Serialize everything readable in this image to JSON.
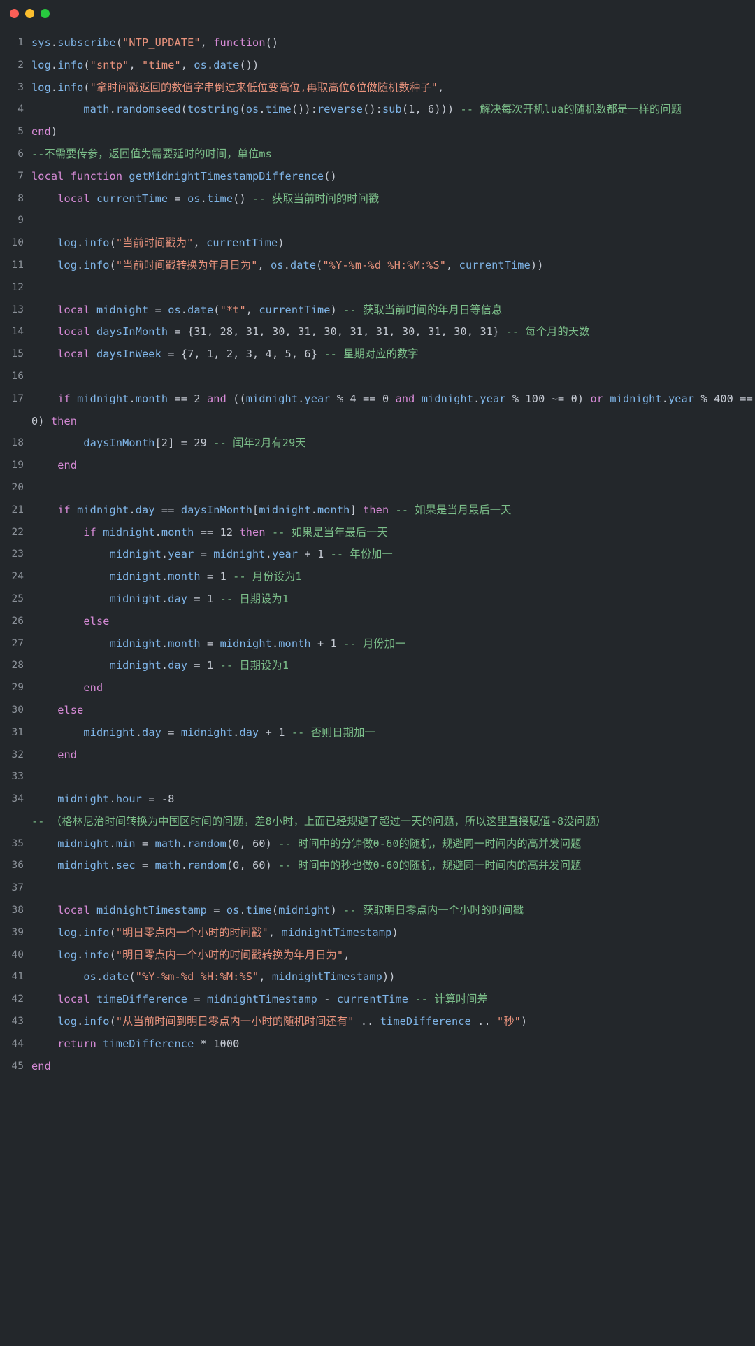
{
  "window": {
    "title": "",
    "controls": [
      {
        "name": "close",
        "color": "#FB5F57"
      },
      {
        "name": "minimize",
        "color": "#FBBE2E"
      },
      {
        "name": "maximize",
        "color": "#28C93F"
      }
    ]
  },
  "editor": {
    "language": "lua",
    "theme": {
      "background": "#23272b",
      "line_number": "#8b9199",
      "identifier": "#7fb5e8",
      "keyword": "#d58ad5",
      "string": "#e8927c",
      "comment": "#7cbf8a",
      "punctuation": "#c5cad3"
    },
    "lines": [
      {
        "n": "1",
        "text": "sys.subscribe(\"NTP_UPDATE\", function()"
      },
      {
        "n": "2",
        "text": "log.info(\"sntp\", \"time\", os.date())"
      },
      {
        "n": "3",
        "text": "log.info(\"拿时间戳返回的数值字串倒过来低位变高位,再取高位6位做随机数种子\","
      },
      {
        "n": "4",
        "text": "        math.randomseed(tostring(os.time()):reverse():sub(1, 6))) -- 解决每次开机lua的随机数都是一样的问题"
      },
      {
        "n": "5",
        "text": "end)"
      },
      {
        "n": "6",
        "text": "--不需要传参，返回值为需要延时的时间，单位ms"
      },
      {
        "n": "7",
        "text": "local function getMidnightTimestampDifference()"
      },
      {
        "n": "8",
        "text": "    local currentTime = os.time() -- 获取当前时间的时间戳"
      },
      {
        "n": "9",
        "text": ""
      },
      {
        "n": "10",
        "text": "    log.info(\"当前时间戳为\", currentTime)"
      },
      {
        "n": "11",
        "text": "    log.info(\"当前时间戳转换为年月日为\", os.date(\"%Y-%m-%d %H:%M:%S\", currentTime))"
      },
      {
        "n": "12",
        "text": ""
      },
      {
        "n": "13",
        "text": "    local midnight = os.date(\"*t\", currentTime) -- 获取当前时间的年月日等信息"
      },
      {
        "n": "14",
        "text": "    local daysInMonth = {31, 28, 31, 30, 31, 30, 31, 31, 30, 31, 30, 31} -- 每个月的天数"
      },
      {
        "n": "15",
        "text": "    local daysInWeek = {7, 1, 2, 3, 4, 5, 6} -- 星期对应的数字"
      },
      {
        "n": "16",
        "text": ""
      },
      {
        "n": "17",
        "text": "    if midnight.month == 2 and ((midnight.year % 4 == 0 and midnight.year % 100 ~= 0) or midnight.year % 400 == 0) then"
      },
      {
        "n": "18",
        "text": "        daysInMonth[2] = 29 -- 闰年2月有29天"
      },
      {
        "n": "19",
        "text": "    end"
      },
      {
        "n": "20",
        "text": ""
      },
      {
        "n": "21",
        "text": "    if midnight.day == daysInMonth[midnight.month] then -- 如果是当月最后一天"
      },
      {
        "n": "22",
        "text": "        if midnight.month == 12 then -- 如果是当年最后一天"
      },
      {
        "n": "23",
        "text": "            midnight.year = midnight.year + 1 -- 年份加一"
      },
      {
        "n": "24",
        "text": "            midnight.month = 1 -- 月份设为1"
      },
      {
        "n": "25",
        "text": "            midnight.day = 1 -- 日期设为1"
      },
      {
        "n": "26",
        "text": "        else"
      },
      {
        "n": "27",
        "text": "            midnight.month = midnight.month + 1 -- 月份加一"
      },
      {
        "n": "28",
        "text": "            midnight.day = 1 -- 日期设为1"
      },
      {
        "n": "29",
        "text": "        end"
      },
      {
        "n": "30",
        "text": "    else"
      },
      {
        "n": "31",
        "text": "        midnight.day = midnight.day + 1 -- 否则日期加一"
      },
      {
        "n": "32",
        "text": "    end"
      },
      {
        "n": "33",
        "text": ""
      },
      {
        "n": "34",
        "text": "    midnight.hour = -8 -- （格林尼治时间转换为中国区时间的问题，差8小时，上面已经规避了超过一天的问题，所以这里直接赋值-8没问题）"
      },
      {
        "n": "35",
        "text": "    midnight.min = math.random(0, 60) -- 时间中的分钟做0-60的随机，规避同一时间内的高并发问题"
      },
      {
        "n": "36",
        "text": "    midnight.sec = math.random(0, 60) -- 时间中的秒也做0-60的随机，规避同一时间内的高并发问题"
      },
      {
        "n": "37",
        "text": ""
      },
      {
        "n": "38",
        "text": "    local midnightTimestamp = os.time(midnight) -- 获取明日零点内一个小时的时间戳"
      },
      {
        "n": "39",
        "text": "    log.info(\"明日零点内一个小时的时间戳\", midnightTimestamp)"
      },
      {
        "n": "40",
        "text": "    log.info(\"明日零点内一个小时的时间戳转换为年月日为\","
      },
      {
        "n": "41",
        "text": "        os.date(\"%Y-%m-%d %H:%M:%S\", midnightTimestamp))"
      },
      {
        "n": "42",
        "text": "    local timeDifference = midnightTimestamp - currentTime -- 计算时间差"
      },
      {
        "n": "43",
        "text": "    log.info(\"从当前时间到明日零点内一小时的随机时间还有\" .. timeDifference .. \"秒\")"
      },
      {
        "n": "44",
        "text": "    return timeDifference * 1000"
      },
      {
        "n": "45",
        "text": "end"
      }
    ]
  }
}
